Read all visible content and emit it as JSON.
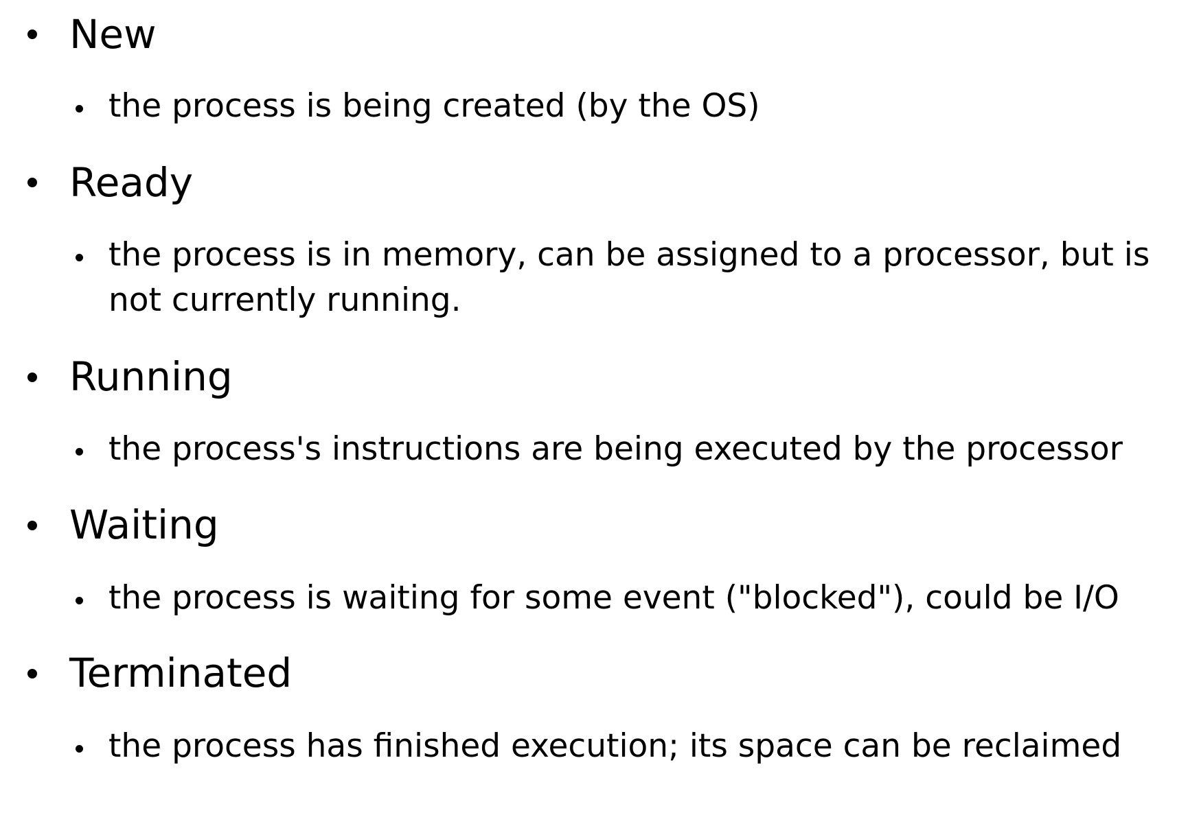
{
  "states": [
    {
      "term": "New",
      "description": "the process is being created (by the OS)"
    },
    {
      "term": "Ready",
      "description": "the process is in memory, can be assigned to a processor, but is not currently running."
    },
    {
      "term": "Running",
      "description": "the process's instructions are being executed by the processor"
    },
    {
      "term": "Waiting",
      "description": "the process is waiting for some event (\"blocked\"), could be I/O"
    },
    {
      "term": "Terminated",
      "description": "the process has finished execution; its space can be reclaimed"
    }
  ]
}
